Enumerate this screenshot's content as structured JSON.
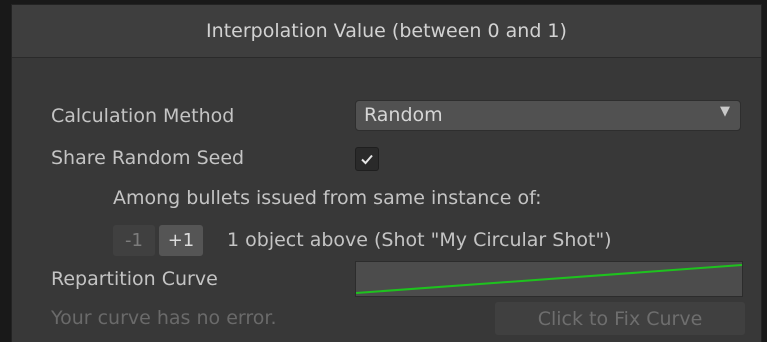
{
  "header": {
    "title": "Interpolation Value (between 0 and 1)"
  },
  "calculation_method": {
    "label": "Calculation Method",
    "value": "Random"
  },
  "share_random_seed": {
    "label": "Share Random Seed",
    "checked": true
  },
  "seed_scope": {
    "description": "Among bullets issued from same instance of:",
    "minus_label": "-1",
    "plus_label": "+1",
    "target_text": "1 object above (Shot \"My Circular Shot\")"
  },
  "repartition_curve": {
    "label": "Repartition Curve",
    "curve_color": "#1ec21e"
  },
  "status": {
    "message": "Your curve has no error.",
    "fix_button_label": "Click to Fix Curve"
  }
}
